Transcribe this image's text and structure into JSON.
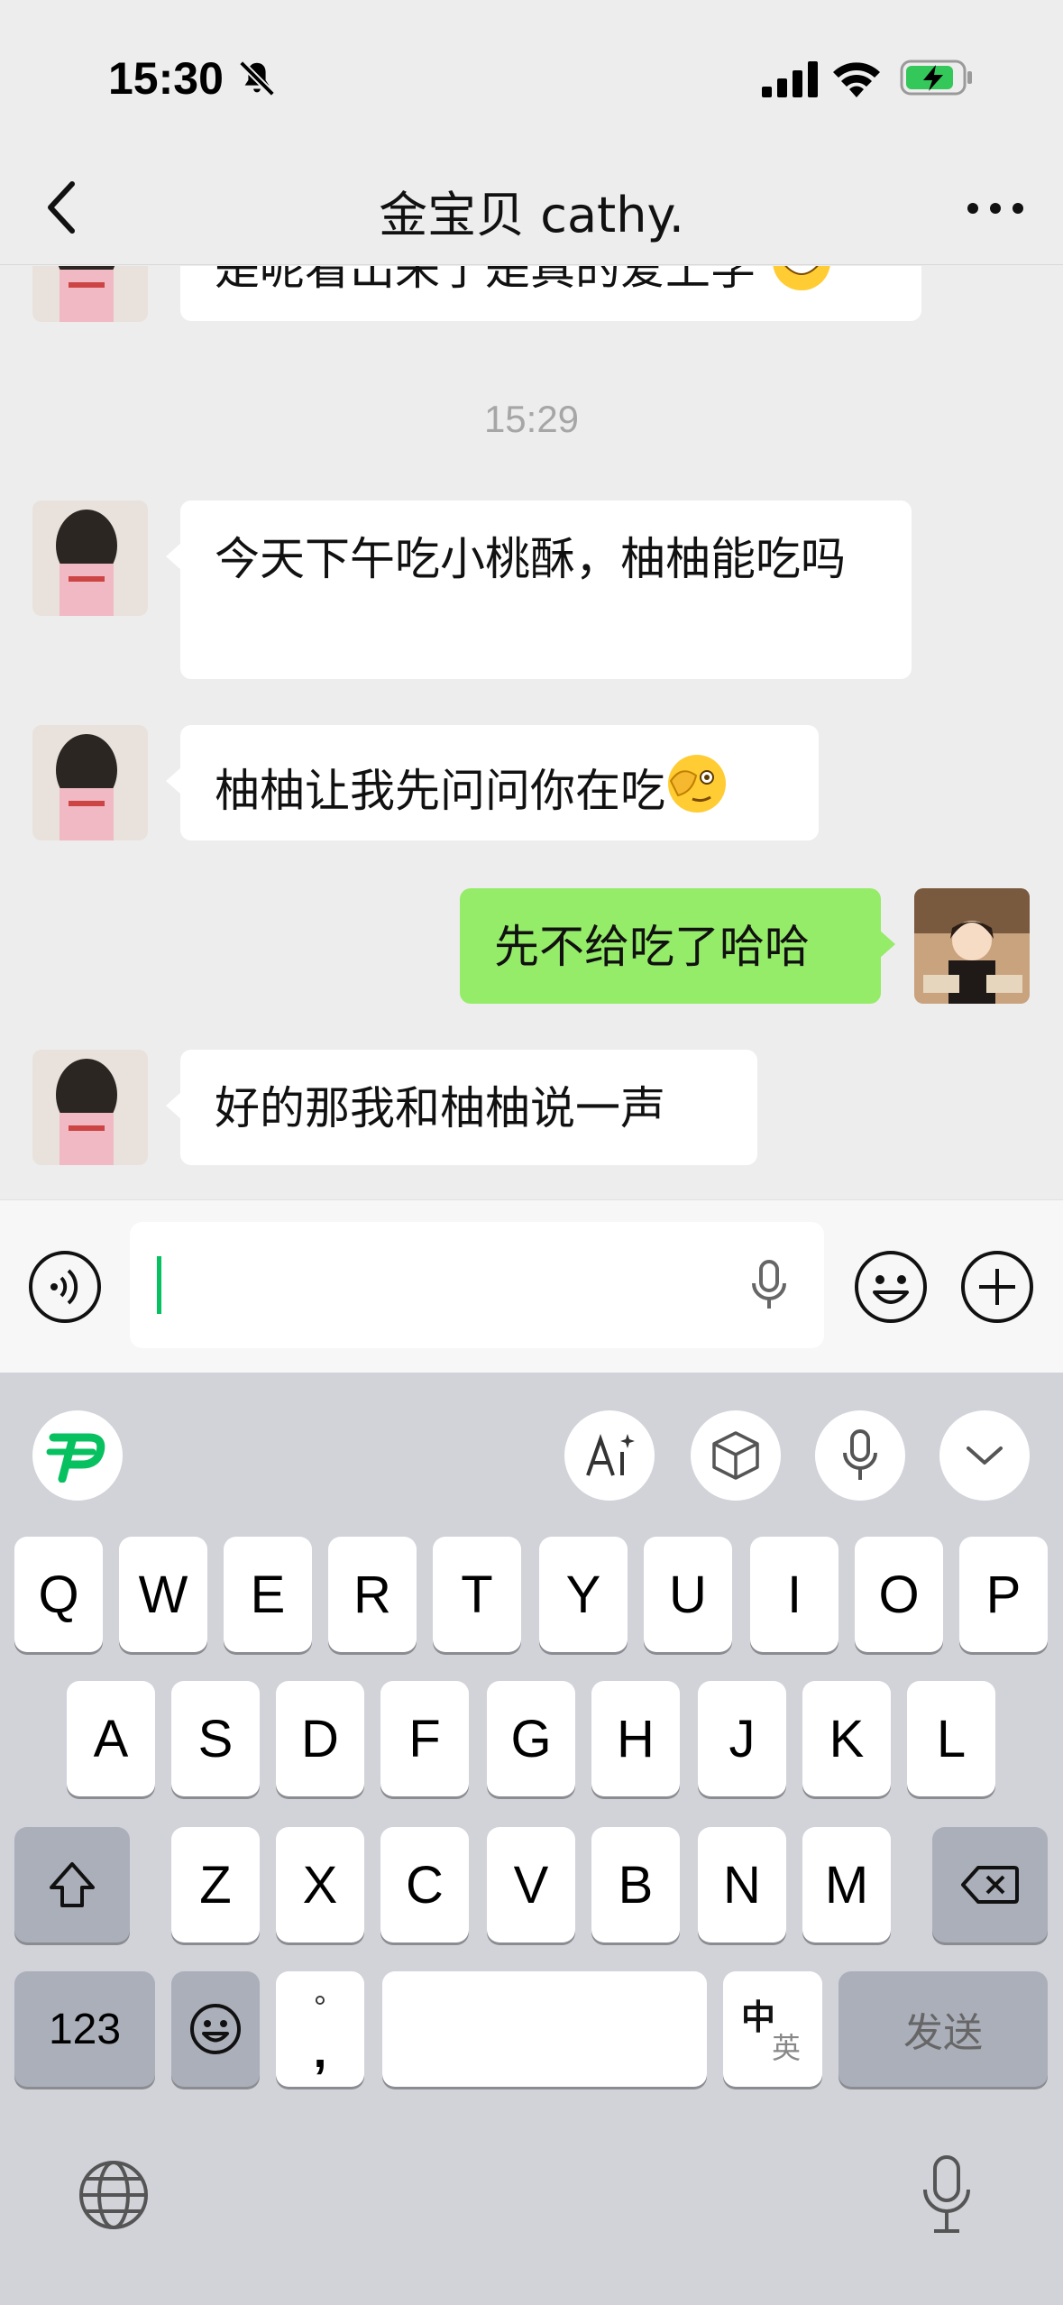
{
  "status_bar": {
    "time": "15:30"
  },
  "nav": {
    "title": "金宝贝 cathy."
  },
  "messages": {
    "partial_text": "是呢看出来了是真的爱上学",
    "timestamp": "15:29",
    "msg1": "今天下午吃小桃酥，柚柚能吃吗",
    "msg2": "柚柚让我先问问你在吃",
    "msg3_out": "先不给吃了哈哈",
    "msg4": "好的那我和柚柚说一声"
  },
  "input": {
    "value": ""
  },
  "keyboard": {
    "row1": [
      "Q",
      "W",
      "E",
      "R",
      "T",
      "Y",
      "U",
      "I",
      "O",
      "P"
    ],
    "row2": [
      "A",
      "S",
      "D",
      "F",
      "G",
      "H",
      "J",
      "K",
      "L"
    ],
    "row3": [
      "Z",
      "X",
      "C",
      "V",
      "B",
      "N",
      "M"
    ],
    "num_key": "123",
    "punct_top": "°",
    "punct_bottom": ",",
    "lang_zh": "中",
    "lang_en": "英",
    "send_label": "发送"
  },
  "colors": {
    "out_bubble": "#95ec69",
    "cursor": "#07c160",
    "battery": "#34c759"
  }
}
